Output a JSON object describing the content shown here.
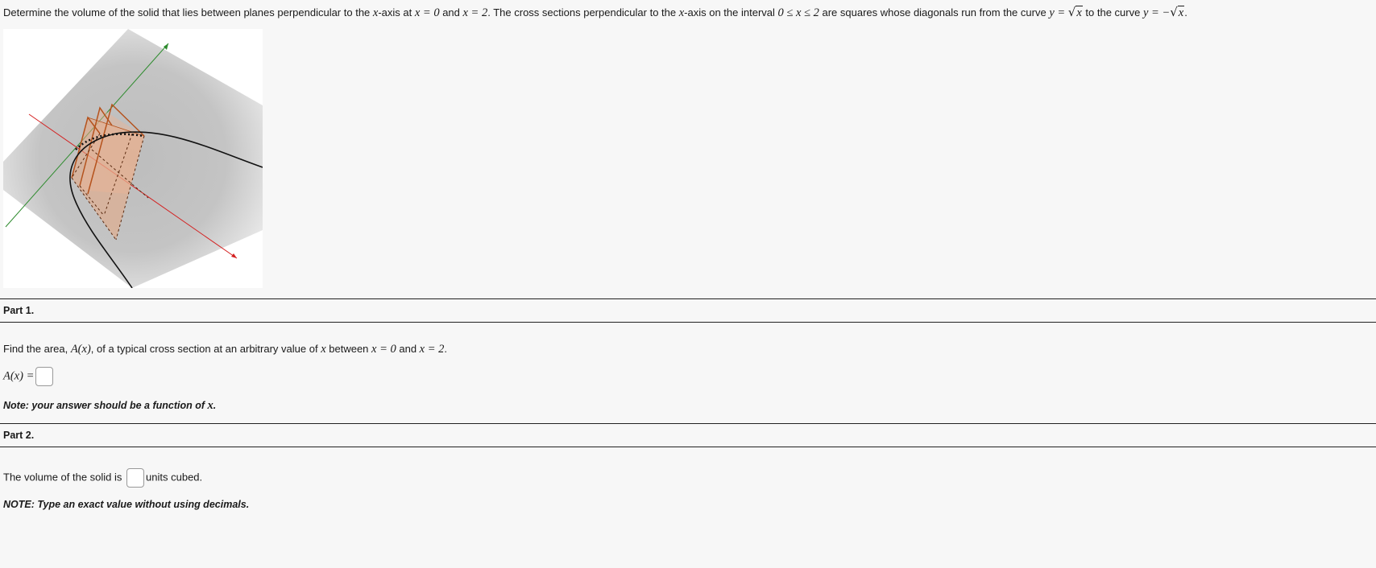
{
  "problem": {
    "t1": "Determine the volume of the solid that lies between planes perpendicular to the ",
    "x": "x",
    "t2": "-axis at ",
    "eq1": "x = 0",
    "and": " and ",
    "eq2": "x = 2",
    "t3": ". The cross sections perpendicular to the ",
    "t4": "-axis on the interval ",
    "ineq": "0 ≤ x ≤ 2",
    "t5": " are squares whose diagonals run from the curve ",
    "yeq": "y = ",
    "t6": " to the curve ",
    "yeqneg": "y = −",
    "end": "."
  },
  "part1": {
    "title": "Part 1.",
    "text1": "Find the area, ",
    "ax": "A(x)",
    "text2": ", of a typical cross section at an arbitrary value of ",
    "x": "x",
    "text3": " between ",
    "eq1": "x = 0",
    "and": " and ",
    "eq2": "x = 2",
    "end": ".",
    "answer_label": "A(x) =",
    "note": "Note: your answer should be a function of ",
    "note_x": "x",
    "note_end": "."
  },
  "part2": {
    "title": "Part 2.",
    "text1": "The volume of the solid is ",
    "text2": "units cubed.",
    "note": "NOTE: Type an exact value without using decimals."
  }
}
